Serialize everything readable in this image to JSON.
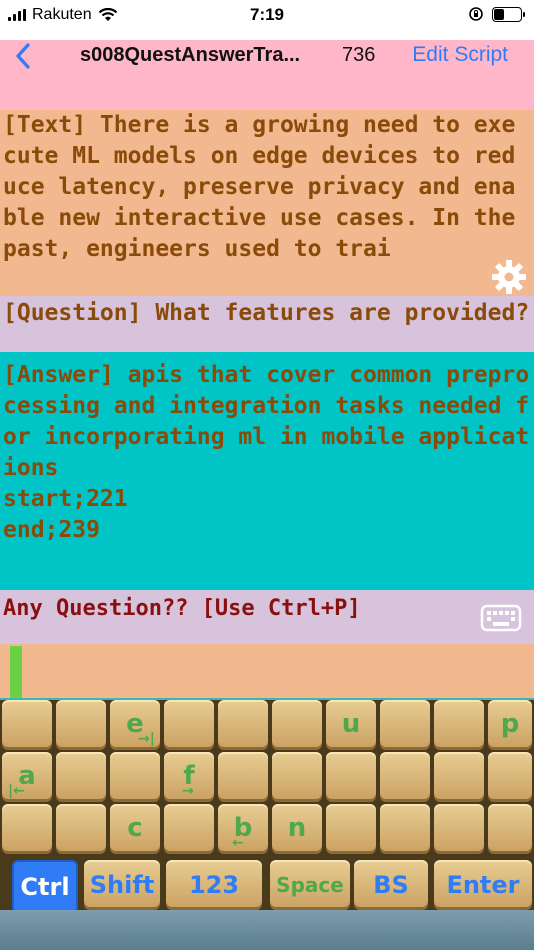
{
  "status": {
    "carrier": "Rakuten",
    "time": "7:19"
  },
  "nav": {
    "title": "s008QuestAnswerTra...",
    "count": "736",
    "edit_label": "Edit Script"
  },
  "text_block": "[Text] There is a growing need to execute ML models on edge devices to reduce latency, preserve privacy and enable new interactive use cases. In the past, engineers used to trai",
  "question_block": "[Question] What features are provided?",
  "answer_block": "[Answer] apis that cover common preprocessing and integration tasks needed for incorporating ml in mobile applications\nstart;221\nend;239",
  "prompt": "Any Question?? [Use Ctrl+P]",
  "keyboard": {
    "row1": [
      "",
      "",
      "e",
      "",
      "",
      "",
      "u",
      "",
      "",
      "p"
    ],
    "row2": [
      "a",
      "",
      "",
      "f",
      "",
      "",
      "",
      "",
      "",
      ""
    ],
    "row3": [
      "",
      "",
      "c",
      "",
      "b",
      "n",
      "",
      "",
      "",
      ""
    ],
    "bottom": [
      "Ctrl",
      "Shift",
      "123",
      "Space",
      "BS",
      "Enter"
    ]
  },
  "colors": {
    "accent": "#2f7cf6",
    "key_text": "#4fa84b",
    "body_text": "#8a4a08",
    "prompt_text": "#8a1010"
  }
}
